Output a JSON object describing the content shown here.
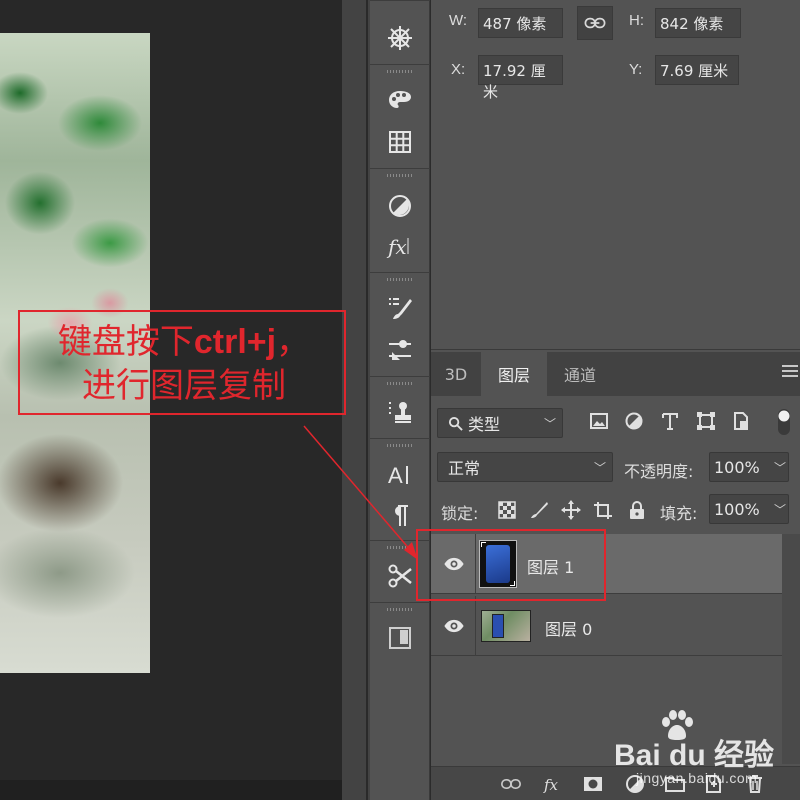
{
  "properties": {
    "w_label": "W:",
    "w_value": "487 像素",
    "h_label": "H:",
    "h_value": "842 像素",
    "x_label": "X:",
    "x_value": "17.92 厘米",
    "y_label": "Y:",
    "y_value": "7.69 厘米"
  },
  "tool_column": {
    "icons": [
      "navigator-icon",
      "palette-icon",
      "grid-icon",
      "adjustments-icon",
      "fx-icon",
      "brush-settings-icon",
      "properties-sliders-icon",
      "clone-stamp-icon",
      "character-icon",
      "paragraph-icon",
      "tool-presets-icon",
      "artboard-icon"
    ],
    "character_label": "A|"
  },
  "layers_panel": {
    "tabs": [
      {
        "label": "3D",
        "active": false
      },
      {
        "label": "图层",
        "active": true
      },
      {
        "label": "通道",
        "active": false
      }
    ],
    "filter_label": "类型",
    "blend_mode": "正常",
    "opacity_label": "不透明度:",
    "opacity_value": "100%",
    "lock_label": "锁定:",
    "fill_label": "填充:",
    "fill_value": "100%",
    "layers": [
      {
        "name": "图层 1",
        "selected": true,
        "visible": true
      },
      {
        "name": "图层 0",
        "selected": false,
        "visible": true
      }
    ]
  },
  "annotation": {
    "line1_prefix": "键盘按下",
    "line1_keys": "ctrl+j",
    "line1_suffix": "，",
    "line2": "进行图层复制",
    "color": "#e0262d"
  },
  "watermark": {
    "brand": "Bai du 经验",
    "url": "jingyan.baidu.com"
  },
  "colors": {
    "panel_bg": "#535353",
    "selected_row": "#6a6a6a",
    "accent_red": "#e0262d"
  }
}
